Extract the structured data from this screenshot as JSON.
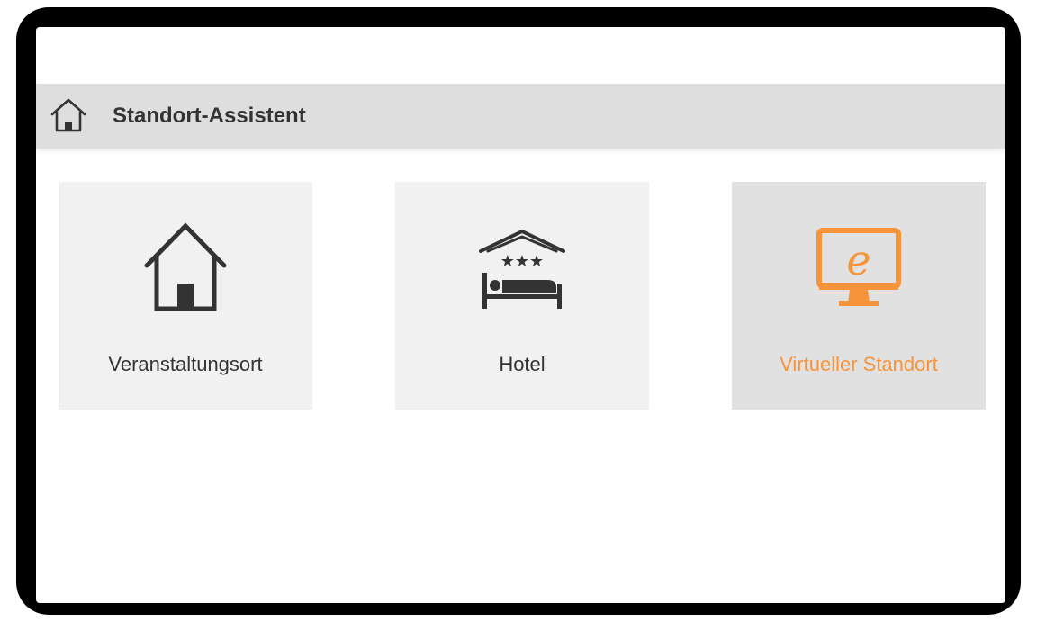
{
  "header": {
    "title": "Standort-Assistent",
    "home_icon": "home-icon"
  },
  "tiles": [
    {
      "label": "Veranstaltungsort",
      "icon": "house-icon",
      "selected": false
    },
    {
      "label": "Hotel",
      "icon": "hotel-bed-icon",
      "selected": false
    },
    {
      "label": "Virtueller Standort",
      "icon": "virtual-monitor-icon",
      "selected": true
    }
  ],
  "colors": {
    "accent": "#f7943a",
    "header_bg": "#dedede",
    "tile_bg": "#f1f1f1",
    "tile_selected_bg": "#e1e1e1",
    "text": "#333333"
  }
}
